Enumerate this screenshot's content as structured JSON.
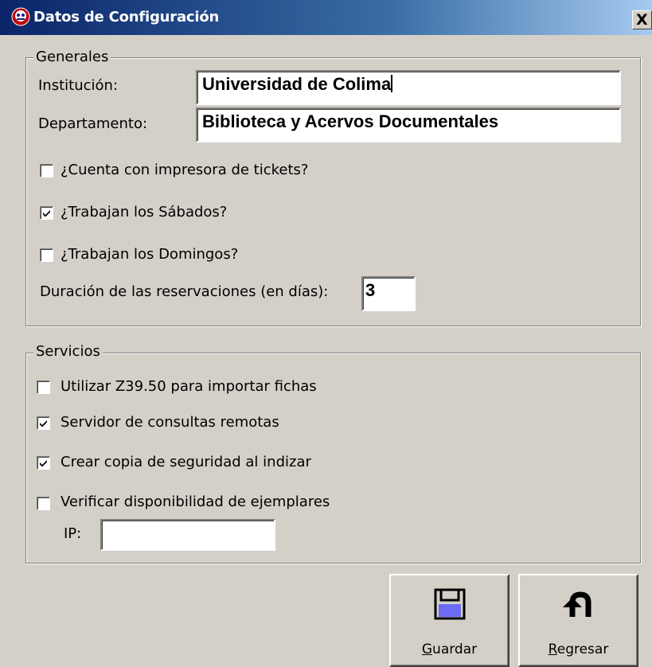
{
  "window": {
    "title": "Datos de Configuración",
    "close_label": "X"
  },
  "generales": {
    "legend": "Generales",
    "institucion_label": "Institución:",
    "institucion_value": "Universidad de Colima",
    "departamento_label": "Departamento:",
    "departamento_value": "Biblioteca y Acervos Documentales",
    "checkboxes": [
      {
        "label": "¿Cuenta con impresora de tickets?",
        "checked": false
      },
      {
        "label": "¿Trabajan los Sábados?",
        "checked": true
      },
      {
        "label": "¿Trabajan los Domingos?",
        "checked": false
      }
    ],
    "duracion_label": "Duración de las reservaciones (en días):",
    "duracion_value": "3"
  },
  "servicios": {
    "legend": "Servicios",
    "checkboxes": [
      {
        "label": "Utilizar Z39.50 para importar fichas",
        "checked": false
      },
      {
        "label": "Servidor de consultas remotas",
        "checked": true
      },
      {
        "label": "Crear copia de seguridad al indizar",
        "checked": true
      },
      {
        "label": "Verificar disponibilidad de ejemplares",
        "checked": false
      }
    ],
    "ip_label": "IP:",
    "ip_value": ""
  },
  "buttons": {
    "guardar_label": "Guardar",
    "regresar_label": "Regresar"
  },
  "icons": {
    "app": "app-logo-icon",
    "guardar": "floppy-disk-icon",
    "regresar": "u-turn-arrow-icon"
  },
  "colors": {
    "titlebar_start": "#0a246a",
    "titlebar_end": "#a6caf0",
    "face": "#d4d0c8"
  }
}
